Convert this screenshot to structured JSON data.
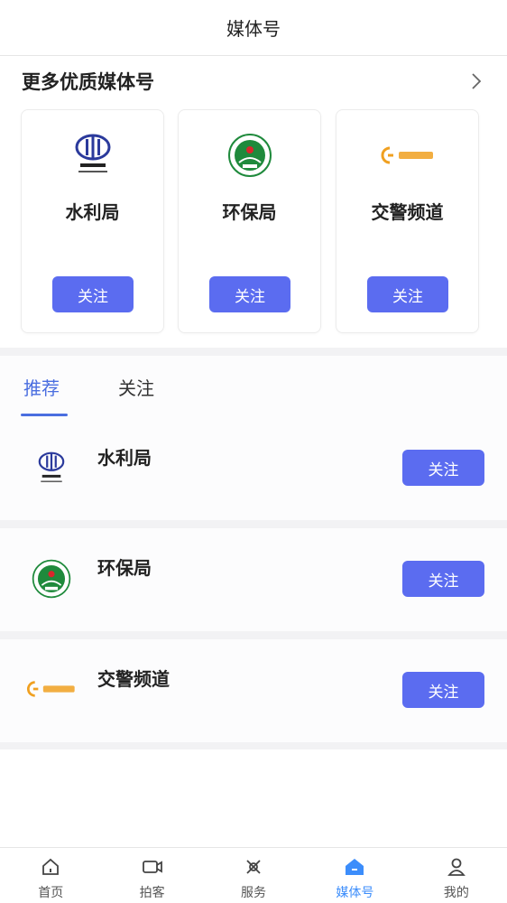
{
  "header": {
    "title": "媒体号"
  },
  "featured": {
    "title": "更多优质媒体号",
    "more_icon": "chevron-right-icon",
    "cards": [
      {
        "name": "水利局",
        "logo_icon": "china-water-logo-icon",
        "follow_label": "关注"
      },
      {
        "name": "环保局",
        "logo_icon": "environmental-protection-emblem-icon",
        "follow_label": "关注"
      },
      {
        "name": "交警频道",
        "logo_icon": "traffic-police-channel-logo-icon",
        "follow_label": "关注"
      }
    ]
  },
  "tabs": [
    {
      "label": "推荐",
      "active": true
    },
    {
      "label": "关注",
      "active": false
    }
  ],
  "list": [
    {
      "name": "水利局",
      "logo_icon": "china-water-logo-icon",
      "follow_label": "关注"
    },
    {
      "name": "环保局",
      "logo_icon": "environmental-protection-emblem-icon",
      "follow_label": "关注"
    },
    {
      "name": "交警频道",
      "logo_icon": "traffic-police-channel-logo-icon",
      "follow_label": "关注"
    }
  ],
  "tabbar": [
    {
      "label": "首页",
      "icon": "home-icon",
      "active": false
    },
    {
      "label": "拍客",
      "icon": "video-camera-icon",
      "active": false
    },
    {
      "label": "服务",
      "icon": "services-icon",
      "active": false
    },
    {
      "label": "媒体号",
      "icon": "media-home-icon",
      "active": true
    },
    {
      "label": "我的",
      "icon": "user-icon",
      "active": false
    }
  ],
  "colors": {
    "accent": "#5b6cf0",
    "tab_active": "#4a6ee0",
    "tabbar_active": "#3c8dfb",
    "logo_blue": "#2b3a9c",
    "logo_green": "#1f8a3c",
    "logo_orange": "#f0a020"
  }
}
